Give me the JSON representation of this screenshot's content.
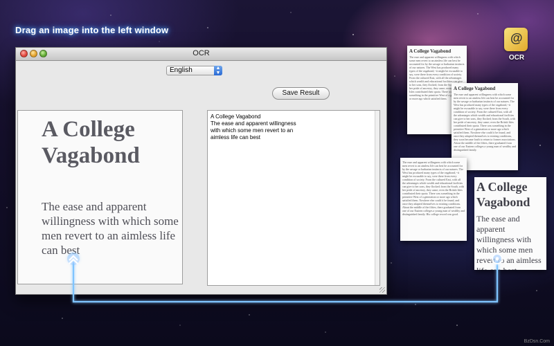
{
  "headline": "Drag an image into the left window",
  "desktop_icon": {
    "label": "OCR"
  },
  "window": {
    "title": "OCR",
    "language": "English",
    "save_label": "Save Result",
    "scan": {
      "title": "A College Vagabond",
      "body": "The ease and apparent willingness with which some men revert to an aimless life can best"
    },
    "ocr_result": {
      "line1": "A College Vagabond",
      "line2": "The ease and apparent  willingness",
      "line3": "with which some men revert to an",
      "line4": "aimless life can best"
    }
  },
  "docs": {
    "doc1": {
      "title": "A College Vagabond",
      "body": "The ease and apparent willingness with which some men revert to an aimless life can best be accounted for by the savage or barbarian instincts of our natures. The West has produced many types of the vagabond,--it might be excusable to say, were there from every condition of society. From the cultured East, with all the advantages which wealth and educational facilities can give to her sons, they flocked; from the South, with her pride of ancestry, they came; even the British Isles contributed their quota. There was something in the primitive West of a generation or more ago which satisfied them."
    },
    "doc2": {
      "title": "A College Vagabond",
      "body": "The ease and apparent willingness with which some men revert to an aimless life can best be accounted for by the savage or barbarian instincts of our natures. The West has produced many types of the vagabond,--it might be excusable to say, were there from every condition of society. From the cultured East, with all the advantages which wealth and educational facilities can give to her sons, they flocked; from the South, with her pride of ancestry, they came; even the British Isles contributed their quota. There was something in the primitive West of a generation or more ago which satisfied them. Nowhere else could it be found, and once they adapted themselves to existing conditions, they soon became loath to return to former associations. About the middle of the fifties, there graduated from one of our Eastern colleges a young man of wealthy and distinguished family."
    },
    "doc3": {
      "title": "",
      "body": "The ease and apparent willingness with which some men revert to an aimless life can best be accounted for by the savage or barbarian instincts of our natures. The West has produced many types of the vagabond,--it might be excusable to say, were there from every condition of society. From the cultured East, with all the advantages which wealth and educational facilities can give to her sons, they flocked; from the South, with her pride of ancestry, they came; even the British Isles contributed their quota. There was something in the primitive West of a generation or more ago which satisfied them. Nowhere else could it be found, and once they adapted themselves to existing conditions. About the middle of the fifties, there graduated from one of our Eastern colleges a young man of wealthy and distinguished family. His college record was good."
    },
    "doc4": {
      "title": "A College Vagabond",
      "body": "The ease and apparent willingness with which some men revert to an aimless life can best"
    }
  },
  "watermark": "BzDsn.Com"
}
